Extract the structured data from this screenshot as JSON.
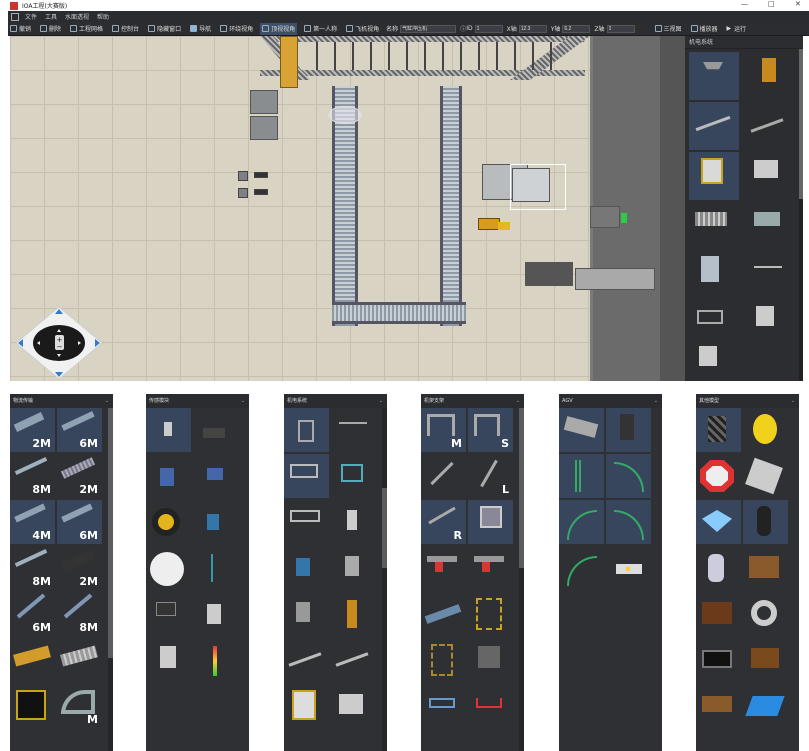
{
  "window": {
    "title": "IOA工程(大赛版)"
  },
  "window_controls": {
    "minimize": "—",
    "maximize": "□",
    "close": "✕"
  },
  "menu": {
    "items": [
      "文件",
      "工具",
      "水面透视",
      "帮助"
    ]
  },
  "toolbar": {
    "buttons": [
      "撤销",
      "删除",
      "工程网格",
      "控制台",
      "隐藏窗口",
      "导航",
      "环绕视角",
      "顶视视角",
      "第一人称",
      "飞机视角"
    ],
    "selected": "顶视视角",
    "name_label": "名称",
    "name_value": "气缸冲压机",
    "id_label": "ID",
    "id_value": "1",
    "x_label": "X轴",
    "x_value": "12.3",
    "y_label": "Y轴",
    "y_value": "6.2",
    "z_label": "Z轴",
    "z_value": "0",
    "right_buttons": [
      "三视图",
      "播放器",
      "运行"
    ]
  },
  "side_panel": {
    "title": "机电系统"
  },
  "panels": [
    {
      "title": "物流传输",
      "labels": [
        "2M",
        "6M",
        "8M",
        "2M",
        "4M",
        "6M",
        "8M",
        "2M",
        "6M",
        "8M",
        "",
        "",
        "",
        "M"
      ]
    },
    {
      "title": "传感模块"
    },
    {
      "title": "机电系统"
    },
    {
      "title": "机架支架",
      "labels": [
        "M",
        "S",
        "",
        "L",
        "R",
        ""
      ]
    },
    {
      "title": "AGV"
    },
    {
      "title": "其他模型"
    }
  ],
  "nav_pad": {
    "zoom_in": "+",
    "zoom_out": "−"
  },
  "icons": [
    "app-icon",
    "undo-icon",
    "delete-icon",
    "grid-icon",
    "console-icon",
    "hide-icon",
    "nav-icon",
    "orbit-icon",
    "top-view-icon",
    "first-person-icon",
    "plane-icon",
    "threeview-icon",
    "player-icon",
    "run-icon",
    "chevron-down-icon"
  ],
  "colors": {
    "accent": "#3d4f66",
    "panel_bg": "#2e3034",
    "highlight": "#37465c",
    "floor": "#d9d3c4"
  }
}
